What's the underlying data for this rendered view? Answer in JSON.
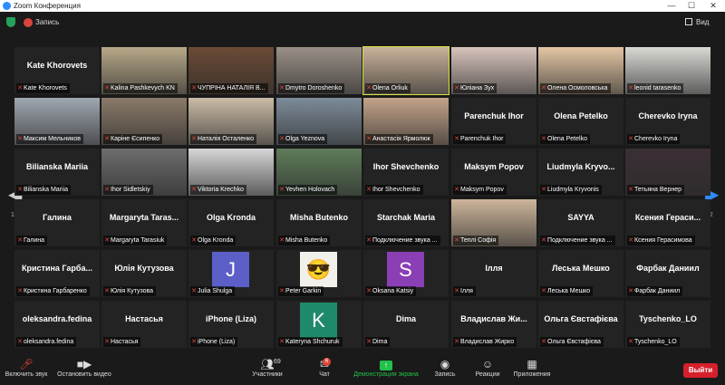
{
  "window": {
    "title": "Zoom Конференция",
    "minimize": "—",
    "maximize": "☐",
    "close": "✕"
  },
  "topbar": {
    "record_label": "Запись",
    "view_label": "Вид"
  },
  "pagination": {
    "left": "1/2",
    "right": "1/2"
  },
  "tiles": [
    {
      "label": "Kate Khorovets",
      "big": "Kate Khorovets",
      "bg": "#232323"
    },
    {
      "label": "Kalina Pashkevych KN",
      "bg": "#b8a889"
    },
    {
      "label": "ЧУПРІНА НАТАЛІЯ В...",
      "bg": "#6b4a35"
    },
    {
      "label": "Dmytro Doroshenko",
      "bg": "#9a9086"
    },
    {
      "label": "Olena Orliuk",
      "bg": "#c9b29a",
      "active": true
    },
    {
      "label": "Юліана Зух",
      "bg": "#d8c4bc"
    },
    {
      "label": "Олена Осмоловська",
      "bg": "#e4c6a4"
    },
    {
      "label": "leonid tarasenko",
      "bg": "#d9d9d4"
    },
    {
      "label": "Максим Мельников",
      "bg": "#9fa7b0"
    },
    {
      "label": "Каріне Єсипенко",
      "bg": "#8b7a68"
    },
    {
      "label": "Наталія Осталенко",
      "bg": "#cbbba6"
    },
    {
      "label": "Olga Yeznova",
      "bg": "#7d8c99"
    },
    {
      "label": "Анастасія Ярмолюк",
      "bg": "#c4a48a"
    },
    {
      "label": "Parenchuk Ihor",
      "big": "Parenchuk Ihor",
      "bg": "#232323"
    },
    {
      "label": "Olena Petelko",
      "big": "Olena Petelko",
      "bg": "#232323"
    },
    {
      "label": "Cherevko Iryna",
      "big": "Cherevko Iryna",
      "bg": "#232323"
    },
    {
      "label": "Bilianska Mariia",
      "big": "Bilianska Mariia",
      "bg": "#232323"
    },
    {
      "label": "Ihor Sidletskiy",
      "bg": "#6d6d6d"
    },
    {
      "label": "Viktoria Krechko",
      "bg": "#d6d6d6"
    },
    {
      "label": "Yevhen Holovach",
      "bg": "#5f7c5a"
    },
    {
      "label": "Ihor Shevchenko",
      "big": "Ihor Shevchenko",
      "bg": "#232323"
    },
    {
      "label": "Maksym Popov",
      "big": "Maksym Popov",
      "bg": "#232323"
    },
    {
      "label": "Liudmyla Kryvonis",
      "big": "Liudmyla  Kryvo...",
      "bg": "#232323"
    },
    {
      "label": "Тетьяна Вернер",
      "bg": "#3a2f35"
    },
    {
      "label": "Галина",
      "big": "Галина",
      "bg": "#232323"
    },
    {
      "label": "Margaryta Tarasiuk",
      "big": "Margaryta  Taras...",
      "bg": "#232323"
    },
    {
      "label": "Olga Kronda",
      "big": "Olga Kronda",
      "bg": "#232323"
    },
    {
      "label": "Misha Butenko",
      "big": "Misha Butenko",
      "bg": "#232323"
    },
    {
      "label": "Подключение звука ...",
      "big": "Starchak Maria",
      "bg": "#232323"
    },
    {
      "label": "Теплі Софія",
      "bg": "#cdb59a"
    },
    {
      "label": "Подключение звука ...",
      "big": "SAYYA",
      "bg": "#1a1a1a"
    },
    {
      "label": "Ксения Герасимова",
      "big": "Ксения  Гераси...",
      "bg": "#232323"
    },
    {
      "label": "Кристина Гарбаренко",
      "big": "Кристина  Гарба...",
      "bg": "#232323"
    },
    {
      "label": "Юлія Кутузова",
      "big": "Юлія Кутузова",
      "bg": "#232323"
    },
    {
      "label": "Julia Shulga",
      "avatar": "J",
      "avatarColor": "#5b5fc7",
      "bg": "#232323"
    },
    {
      "label": "Peter Garkin",
      "avatar": "😎",
      "avatarColor": "#f2f0ea",
      "bg": "#232323"
    },
    {
      "label": "Oksana Katsiy",
      "avatar": "S",
      "avatarColor": "#8a3fb5",
      "bg": "#232323"
    },
    {
      "label": "Ілля",
      "big": "Ілля",
      "bg": "#232323"
    },
    {
      "label": "Леська Мешко",
      "big": "Леська Мешко",
      "bg": "#232323"
    },
    {
      "label": "Фарбак Даниил",
      "big": "Фарбак Даниил",
      "bg": "#232323"
    },
    {
      "label": "oleksandra.fedina",
      "big": "oleksandra.fedina",
      "bg": "#232323"
    },
    {
      "label": "Настасья",
      "big": "Настасья",
      "bg": "#232323"
    },
    {
      "label": "iPhone (Liza)",
      "big": "iPhone (Liza)",
      "bg": "#232323"
    },
    {
      "label": "Kateryna Shchuruk",
      "avatar": "K",
      "avatarColor": "#1f8a6b",
      "bg": "#232323"
    },
    {
      "label": "Dima",
      "big": "Dima",
      "bg": "#232323"
    },
    {
      "label": "Владислав Жирко",
      "big": "Владислав  Жи...",
      "bg": "#232323"
    },
    {
      "label": "Ольга Євстафієва",
      "big": "Ольга Євстафієва",
      "bg": "#232323"
    },
    {
      "label": "Tyschenko_LO",
      "big": "Tyschenko_LO",
      "bg": "#232323"
    }
  ],
  "toolbar": {
    "audio": "Включить звук",
    "video": "Остановить видео",
    "participants": "Участники",
    "participants_count": "69",
    "chat": "Чат",
    "chat_badge": "6",
    "share": "Демонстрация экрана",
    "record": "Запись",
    "reactions": "Реакции",
    "apps": "Приложения",
    "exit": "Выйти"
  }
}
